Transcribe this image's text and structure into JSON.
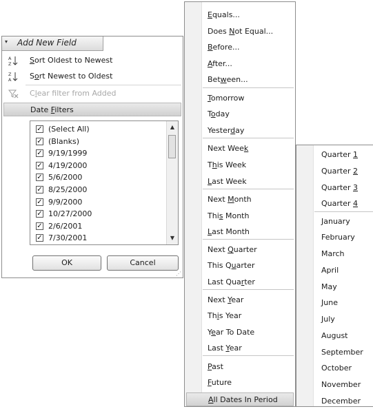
{
  "field_header": {
    "title": "Add New Field",
    "arrow": "▾"
  },
  "filter_menu": {
    "sort_oldest_pre": "",
    "sort_oldest_key": "S",
    "sort_oldest_post": "ort Oldest to Newest",
    "sort_newest_pre": "S",
    "sort_newest_key": "o",
    "sort_newest_post": "rt Newest to Oldest",
    "clear_pre": "C",
    "clear_key": "l",
    "clear_post": "ear filter from Added",
    "date_filters_pre": "Date ",
    "date_filters_key": "F",
    "date_filters_post": "ilters"
  },
  "values": [
    {
      "label": "(Select All)",
      "checked": true
    },
    {
      "label": "(Blanks)",
      "checked": true
    },
    {
      "label": "9/19/1999",
      "checked": true
    },
    {
      "label": "4/19/2000",
      "checked": true
    },
    {
      "label": "5/6/2000",
      "checked": true
    },
    {
      "label": "8/25/2000",
      "checked": true
    },
    {
      "label": "9/9/2000",
      "checked": true
    },
    {
      "label": "10/27/2000",
      "checked": true
    },
    {
      "label": "2/6/2001",
      "checked": true
    },
    {
      "label": "7/30/2001",
      "checked": true
    }
  ],
  "check_glyph": "✓",
  "buttons": {
    "ok": "OK",
    "cancel": "Cancel"
  },
  "date_submenu": [
    {
      "pre": "",
      "key": "E",
      "post": "quals..."
    },
    {
      "pre": "Does ",
      "key": "N",
      "post": "ot Equal..."
    },
    {
      "pre": "",
      "key": "B",
      "post": "efore..."
    },
    {
      "pre": "",
      "key": "A",
      "post": "fter..."
    },
    {
      "pre": "Bet",
      "key": "w",
      "post": "een..."
    },
    {
      "pre": "",
      "key": "T",
      "post": "omorrow"
    },
    {
      "pre": "T",
      "key": "o",
      "post": "day"
    },
    {
      "pre": "Yester",
      "key": "d",
      "post": "ay"
    },
    {
      "pre": "Next Wee",
      "key": "k",
      "post": ""
    },
    {
      "pre": "T",
      "key": "h",
      "post": "is Week"
    },
    {
      "pre": "",
      "key": "L",
      "post": "ast Week"
    },
    {
      "pre": "Next ",
      "key": "M",
      "post": "onth"
    },
    {
      "pre": "Thi",
      "key": "s",
      "post": " Month"
    },
    {
      "pre": "",
      "key": "L",
      "post": "ast Month"
    },
    {
      "pre": "Next ",
      "key": "Q",
      "post": "uarter"
    },
    {
      "pre": "This Q",
      "key": "u",
      "post": "arter"
    },
    {
      "pre": "Last Qua",
      "key": "r",
      "post": "ter"
    },
    {
      "pre": "Next ",
      "key": "Y",
      "post": "ear"
    },
    {
      "pre": "Th",
      "key": "i",
      "post": "s Year"
    },
    {
      "pre": "Y",
      "key": "e",
      "post": "ar To Date"
    },
    {
      "pre": "Last ",
      "key": "Y",
      "post": "ear"
    },
    {
      "pre": "",
      "key": "P",
      "post": "ast"
    },
    {
      "pre": "",
      "key": "F",
      "post": "uture"
    }
  ],
  "all_dates": {
    "pre": "",
    "key": "A",
    "post": "ll Dates In Period"
  },
  "period_submenu": [
    {
      "pre": "Quarter ",
      "key": "1",
      "post": ""
    },
    {
      "pre": "Quarter ",
      "key": "2",
      "post": ""
    },
    {
      "pre": "Quarter ",
      "key": "3",
      "post": ""
    },
    {
      "pre": "Quarter ",
      "key": "4",
      "post": ""
    },
    {
      "pre": "January",
      "key": "",
      "post": ""
    },
    {
      "pre": "February",
      "key": "",
      "post": ""
    },
    {
      "pre": "March",
      "key": "",
      "post": ""
    },
    {
      "pre": "April",
      "key": "",
      "post": ""
    },
    {
      "pre": "May",
      "key": "",
      "post": ""
    },
    {
      "pre": "June",
      "key": "",
      "post": ""
    },
    {
      "pre": "July",
      "key": "",
      "post": ""
    },
    {
      "pre": "August",
      "key": "",
      "post": ""
    },
    {
      "pre": "September",
      "key": "",
      "post": ""
    },
    {
      "pre": "October",
      "key": "",
      "post": ""
    },
    {
      "pre": "November",
      "key": "",
      "post": ""
    },
    {
      "pre": "December",
      "key": "",
      "post": ""
    }
  ]
}
